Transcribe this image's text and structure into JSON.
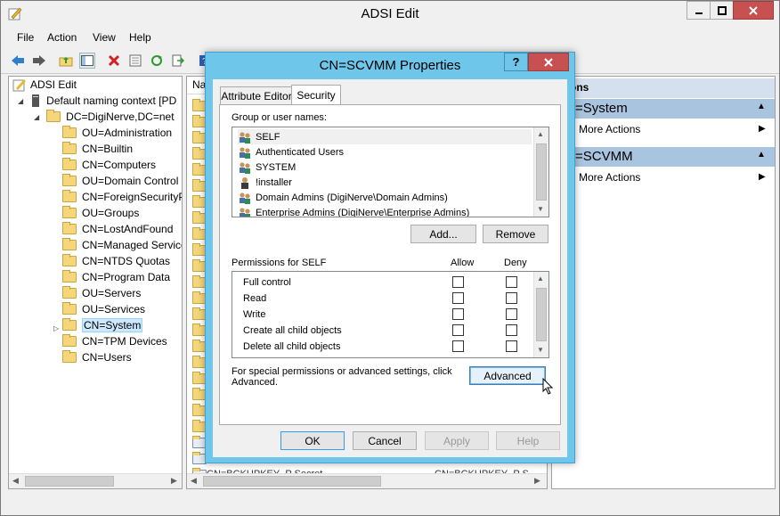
{
  "window": {
    "title": "ADSI Edit"
  },
  "menu": [
    "File",
    "Action",
    "View",
    "Help"
  ],
  "tree": {
    "root": "ADSI Edit",
    "context": "Default naming context [PD",
    "domain": "DC=DigiNerve,DC=net",
    "items": [
      "OU=Administration",
      "CN=Builtin",
      "CN=Computers",
      "OU=Domain Control",
      "CN=ForeignSecurityP",
      "OU=Groups",
      "CN=LostAndFound",
      "CN=Managed Service",
      "CN=NTDS Quotas",
      "CN=Program Data",
      "OU=Servers",
      "OU=Services",
      "CN=System",
      "CN=TPM Devices",
      "CN=Users"
    ],
    "selected": "CN=System"
  },
  "middle": {
    "header": "Na",
    "bottom_text_1": "CN=BCKUPKEY_P Secret",
    "bottom_text_2": "CN=BCKUPKEY_P S"
  },
  "actions": {
    "header": "ons",
    "sections": [
      {
        "title": "=System",
        "item": "More Actions"
      },
      {
        "title": "=SCVMM",
        "item": "More Actions"
      }
    ]
  },
  "dialog": {
    "title": "CN=SCVMM Properties",
    "help": "?",
    "tabs": [
      "Attribute Editor",
      "Security"
    ],
    "active_tab": "Security",
    "group_label": "Group or user names:",
    "users": [
      "SELF",
      "Authenticated Users",
      "SYSTEM",
      "!installer",
      "Domain Admins (DigiNerve\\Domain Admins)",
      "Enterprise Admins (DigiNerve\\Enterprise Admins)"
    ],
    "add_label": "Add...",
    "remove_label": "Remove",
    "perm_label": "Permissions for SELF",
    "allow_label": "Allow",
    "deny_label": "Deny",
    "permissions": [
      "Full control",
      "Read",
      "Write",
      "Create all child objects",
      "Delete all child objects"
    ],
    "special_text_1": "For special permissions or advanced settings, click",
    "special_text_2": "Advanced.",
    "advanced_label": "Advanced",
    "ok_label": "OK",
    "cancel_label": "Cancel",
    "apply_label": "Apply",
    "helpbtn_label": "Help"
  },
  "colors": {
    "dialog_frame": "#6ec6ea",
    "close_button": "#c75050",
    "action_section": "#a9c4de"
  }
}
